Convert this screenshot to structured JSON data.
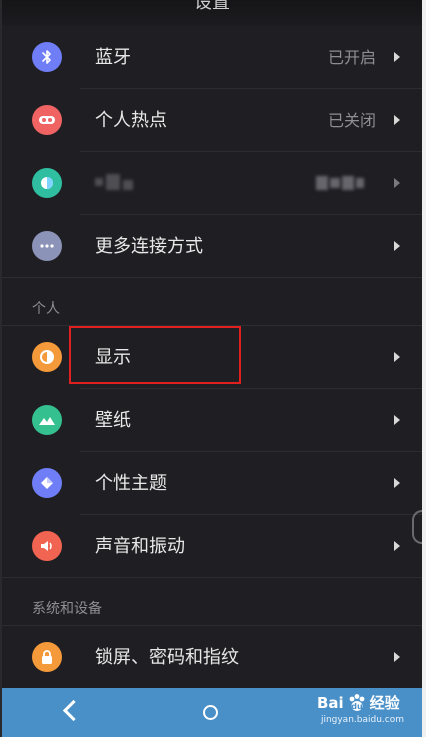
{
  "topbar": {
    "title": "设置"
  },
  "rows_group1": [
    {
      "name": "bluetooth",
      "label": "蓝牙",
      "value": "已开启",
      "icon": "bluetooth-icon",
      "color": "#6f7ef6"
    },
    {
      "name": "hotspot",
      "label": "个人热点",
      "value": "已关闭",
      "icon": "hotspot-icon",
      "color": "#f06363"
    },
    {
      "name": "blurred",
      "label": "",
      "value": "",
      "icon": "network-icon",
      "color": "#2fbfa0"
    },
    {
      "name": "more-connections",
      "label": "更多连接方式",
      "value": "",
      "icon": "more-icon",
      "color": "#8c93b8"
    }
  ],
  "section_personal": {
    "title": "个人"
  },
  "rows_group2": [
    {
      "name": "display",
      "label": "显示",
      "icon": "display-icon",
      "color": "#f59a3a"
    },
    {
      "name": "wallpaper",
      "label": "壁纸",
      "icon": "wallpaper-icon",
      "color": "#34c08f"
    },
    {
      "name": "theme",
      "label": "个性主题",
      "icon": "theme-icon",
      "color": "#6f7ef6"
    },
    {
      "name": "sound",
      "label": "声音和振动",
      "icon": "sound-icon",
      "color": "#f26452"
    }
  ],
  "section_system": {
    "title": "系统和设备"
  },
  "rows_group3": [
    {
      "name": "lockscreen",
      "label": "锁屏、密码和指纹",
      "icon": "lock-icon",
      "color": "#f59a3a"
    }
  ],
  "navbar": {
    "back": "back-icon",
    "home": "home-icon"
  },
  "watermark": {
    "brand": "Bai",
    "brand_suffix": "经验",
    "sub": "jingyan.baidu.com"
  },
  "colors": {
    "background": "#1f1f23",
    "navbar": "#4a90c8",
    "highlight": "#e02020"
  }
}
